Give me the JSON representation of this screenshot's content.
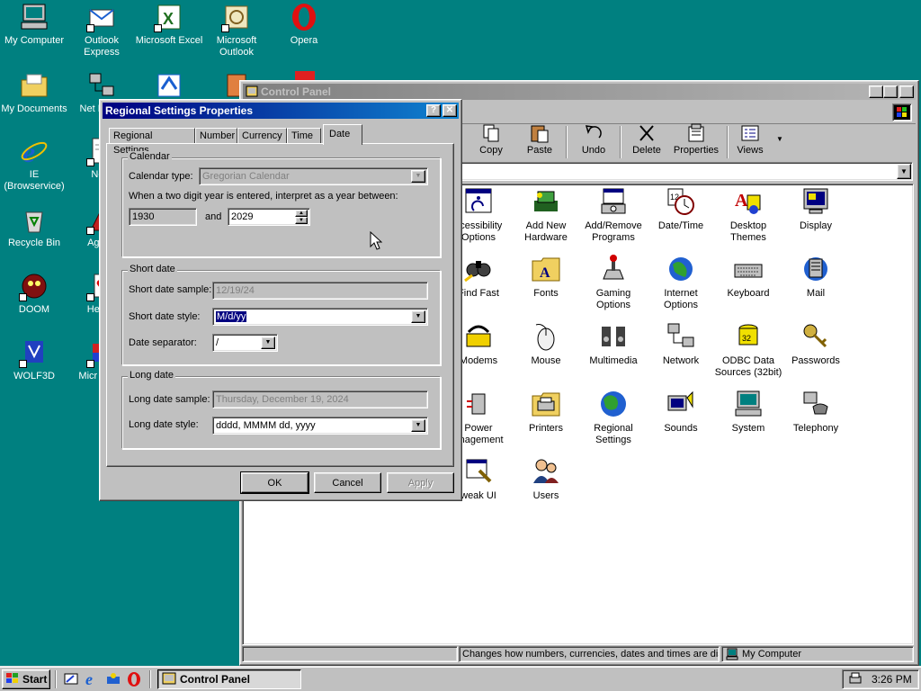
{
  "desktop": {
    "icons": [
      {
        "label": "My Computer",
        "icon": "computer-icon"
      },
      {
        "label": "Outlook Express",
        "icon": "outlook-express-icon"
      },
      {
        "label": "Microsoft Excel",
        "icon": "excel-icon"
      },
      {
        "label": "Microsoft Outlook",
        "icon": "outlook-icon"
      },
      {
        "label": "Opera",
        "icon": "opera-icon"
      },
      {
        "label": "My Documents",
        "icon": "folder-icon"
      },
      {
        "label": "Net Neigh",
        "icon": "network-icon"
      },
      {
        "label": "IE (Browservice)",
        "icon": "ie-icon"
      },
      {
        "label": "Note",
        "icon": "notepad-icon"
      },
      {
        "label": "Recycle Bin",
        "icon": "recycle-bin-icon"
      },
      {
        "label": "Age of",
        "icon": "game-icon"
      },
      {
        "label": "DOOM",
        "icon": "doom-icon"
      },
      {
        "label": "Hearts",
        "icon": "hearts-icon"
      },
      {
        "label": "WOLF3D",
        "icon": "wolf3d-icon"
      },
      {
        "label": "Micr Visua",
        "icon": "visual-studio-icon"
      }
    ]
  },
  "control_panel": {
    "title": "Control Panel",
    "toolbar": [
      {
        "label": "Copy",
        "icon": "copy-icon"
      },
      {
        "label": "Paste",
        "icon": "paste-icon"
      },
      {
        "label": "Undo",
        "icon": "undo-icon"
      },
      {
        "label": "Delete",
        "icon": "delete-icon"
      },
      {
        "label": "Properties",
        "icon": "properties-icon"
      },
      {
        "label": "Views",
        "icon": "views-icon"
      }
    ],
    "items": [
      {
        "label": "ccessibility Options",
        "icon": "accessibility-icon"
      },
      {
        "label": "Add New Hardware",
        "icon": "add-hardware-icon"
      },
      {
        "label": "Add/Remove Programs",
        "icon": "add-remove-programs-icon"
      },
      {
        "label": "Date/Time",
        "icon": "date-time-icon"
      },
      {
        "label": "Desktop Themes",
        "icon": "desktop-themes-icon"
      },
      {
        "label": "Display",
        "icon": "display-icon"
      },
      {
        "label": "Find Fast",
        "icon": "find-fast-icon"
      },
      {
        "label": "Fonts",
        "icon": "fonts-icon"
      },
      {
        "label": "Gaming Options",
        "icon": "gaming-icon"
      },
      {
        "label": "Internet Options",
        "icon": "internet-options-icon"
      },
      {
        "label": "Keyboard",
        "icon": "keyboard-icon"
      },
      {
        "label": "Mail",
        "icon": "mail-icon"
      },
      {
        "label": "Modems",
        "icon": "modems-icon"
      },
      {
        "label": "Mouse",
        "icon": "mouse-icon"
      },
      {
        "label": "Multimedia",
        "icon": "multimedia-icon"
      },
      {
        "label": "Network",
        "icon": "network-icon"
      },
      {
        "label": "ODBC Data Sources (32bit)",
        "icon": "odbc-icon"
      },
      {
        "label": "Passwords",
        "icon": "passwords-icon"
      },
      {
        "label": "Power anagement",
        "icon": "power-icon"
      },
      {
        "label": "Printers",
        "icon": "printers-icon"
      },
      {
        "label": "Regional Settings",
        "icon": "regional-settings-icon"
      },
      {
        "label": "Sounds",
        "icon": "sounds-icon"
      },
      {
        "label": "System",
        "icon": "system-icon"
      },
      {
        "label": "Telephony",
        "icon": "telephony-icon"
      },
      {
        "label": "weak UI",
        "icon": "tweak-ui-icon"
      },
      {
        "label": "Users",
        "icon": "users-icon"
      }
    ],
    "status_text": "Changes how numbers, currencies, dates and times are displ",
    "status_location": "My Computer"
  },
  "dialog": {
    "title": "Regional Settings Properties",
    "tabs": [
      "Regional Settings",
      "Number",
      "Currency",
      "Time",
      "Date"
    ],
    "calendar": {
      "legend": "Calendar",
      "type_label": "Calendar type:",
      "type_value": "Gregorian Calendar",
      "two_digit_text": "When a two digit year is entered, interpret as a year between:",
      "year_from": "1930",
      "and_label": "and",
      "year_to": "2029"
    },
    "short_date": {
      "legend": "Short date",
      "sample_label": "Short date sample:",
      "sample_value": "12/19/24",
      "style_label": "Short date style:",
      "style_value": "M/d/yy",
      "separator_label": "Date separator:",
      "separator_value": "/"
    },
    "long_date": {
      "legend": "Long date",
      "sample_label": "Long date sample:",
      "sample_value": "Thursday, December 19, 2024",
      "style_label": "Long date style:",
      "style_value": "dddd, MMMM dd, yyyy"
    },
    "buttons": {
      "ok": "OK",
      "cancel": "Cancel",
      "apply": "Apply"
    }
  },
  "taskbar": {
    "start": "Start",
    "task": "Control Panel",
    "clock": "3:26 PM"
  },
  "colors": {
    "desktop": "#008080",
    "active_title": "#000080",
    "inactive_title": "#808080",
    "selection": "#000080"
  }
}
